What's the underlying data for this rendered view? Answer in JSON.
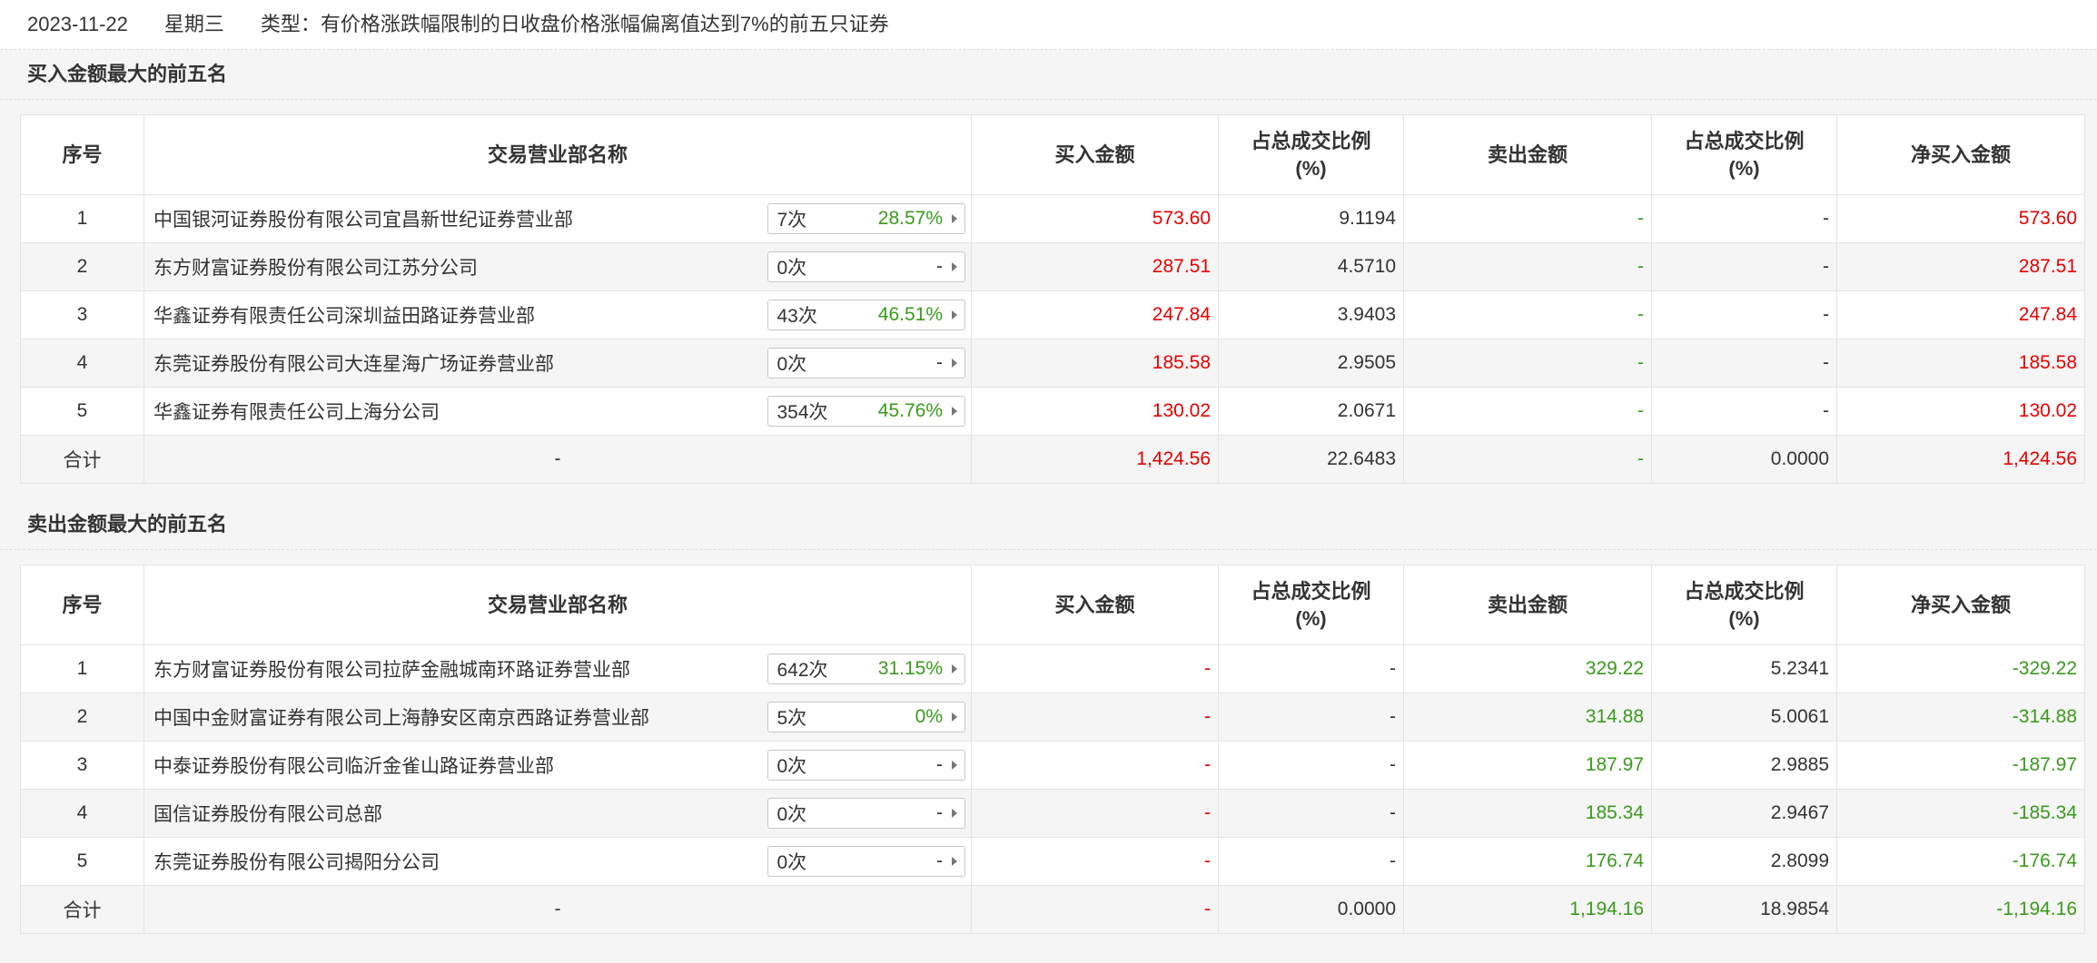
{
  "header": {
    "date": "2023-11-22",
    "weekday": "星期三",
    "type_text": "类型：有价格涨跌幅限制的日收盘价格涨幅偏离值达到7%的前五只证券"
  },
  "columns": {
    "seq": "序号",
    "dept": "交易营业部名称",
    "buy": "买入金额",
    "buy_ratio_l1": "占总成交比例",
    "buy_ratio_l2": "(%)",
    "sell": "卖出金额",
    "sell_ratio_l1": "占总成交比例",
    "sell_ratio_l2": "(%)",
    "net": "净买入金额"
  },
  "colors": {
    "up": "#e60000",
    "down": "#3a9a1c",
    "text": "#333333"
  },
  "buy_section": {
    "title": "买入金额最大的前五名",
    "rows": [
      {
        "seq": "1",
        "name": "中国银河证券股份有限公司宜昌新世纪证券营业部",
        "count": "7次",
        "rate": "28.57%",
        "buy": "573.60",
        "buy_ratio": "9.1194",
        "sell": "-",
        "sell_ratio": "-",
        "net": "573.60"
      },
      {
        "seq": "2",
        "name": "东方财富证券股份有限公司江苏分公司",
        "count": "0次",
        "rate": "-",
        "buy": "287.51",
        "buy_ratio": "4.5710",
        "sell": "-",
        "sell_ratio": "-",
        "net": "287.51"
      },
      {
        "seq": "3",
        "name": "华鑫证券有限责任公司深圳益田路证券营业部",
        "count": "43次",
        "rate": "46.51%",
        "buy": "247.84",
        "buy_ratio": "3.9403",
        "sell": "-",
        "sell_ratio": "-",
        "net": "247.84"
      },
      {
        "seq": "4",
        "name": "东莞证券股份有限公司大连星海广场证券营业部",
        "count": "0次",
        "rate": "-",
        "buy": "185.58",
        "buy_ratio": "2.9505",
        "sell": "-",
        "sell_ratio": "-",
        "net": "185.58"
      },
      {
        "seq": "5",
        "name": "华鑫证券有限责任公司上海分公司",
        "count": "354次",
        "rate": "45.76%",
        "buy": "130.02",
        "buy_ratio": "2.0671",
        "sell": "-",
        "sell_ratio": "-",
        "net": "130.02"
      }
    ],
    "total": {
      "label": "合计",
      "name": "-",
      "buy": "1,424.56",
      "buy_ratio": "22.6483",
      "sell": "-",
      "sell_ratio": "0.0000",
      "net": "1,424.56"
    }
  },
  "sell_section": {
    "title": "卖出金额最大的前五名",
    "rows": [
      {
        "seq": "1",
        "name": "东方财富证券股份有限公司拉萨金融城南环路证券营业部",
        "count": "642次",
        "rate": "31.15%",
        "buy": "-",
        "buy_ratio": "-",
        "sell": "329.22",
        "sell_ratio": "5.2341",
        "net": "-329.22"
      },
      {
        "seq": "2",
        "name": "中国中金财富证券有限公司上海静安区南京西路证券营业部",
        "count": "5次",
        "rate": "0%",
        "buy": "-",
        "buy_ratio": "-",
        "sell": "314.88",
        "sell_ratio": "5.0061",
        "net": "-314.88"
      },
      {
        "seq": "3",
        "name": "中泰证券股份有限公司临沂金雀山路证券营业部",
        "count": "0次",
        "rate": "-",
        "buy": "-",
        "buy_ratio": "-",
        "sell": "187.97",
        "sell_ratio": "2.9885",
        "net": "-187.97"
      },
      {
        "seq": "4",
        "name": "国信证券股份有限公司总部",
        "count": "0次",
        "rate": "-",
        "buy": "-",
        "buy_ratio": "-",
        "sell": "185.34",
        "sell_ratio": "2.9467",
        "net": "-185.34"
      },
      {
        "seq": "5",
        "name": "东莞证券股份有限公司揭阳分公司",
        "count": "0次",
        "rate": "-",
        "buy": "-",
        "buy_ratio": "-",
        "sell": "176.74",
        "sell_ratio": "2.8099",
        "net": "-176.74"
      }
    ],
    "total": {
      "label": "合计",
      "name": "-",
      "buy": "-",
      "buy_ratio": "0.0000",
      "sell": "1,194.16",
      "sell_ratio": "18.9854",
      "net": "-1,194.16"
    }
  }
}
